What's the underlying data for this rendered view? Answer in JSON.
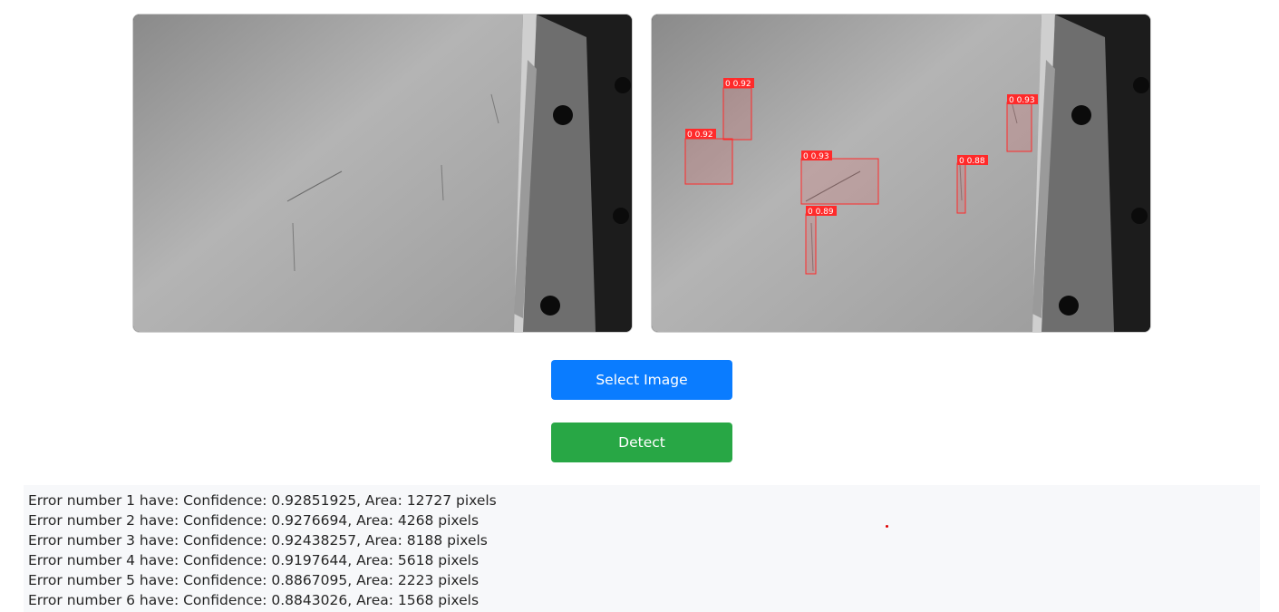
{
  "images": {
    "original": {
      "name": "input-image"
    },
    "result": {
      "name": "detection-result",
      "detections": [
        {
          "label": "0 0.92"
        },
        {
          "label": "0 0.92"
        },
        {
          "label": "0 0.93"
        },
        {
          "label": "0 0.89"
        },
        {
          "label": "0 0.88"
        },
        {
          "label": "0 0.93"
        }
      ]
    }
  },
  "buttons": {
    "select_label": "Select Image",
    "detect_label": "Detect"
  },
  "results": {
    "lines": [
      "Error number 1 have: Confidence: 0.92851925, Area: 12727 pixels",
      "Error number 2 have: Confidence: 0.9276694, Area: 4268 pixels",
      "Error number 3 have: Confidence: 0.92438257, Area: 8188 pixels",
      "Error number 4 have: Confidence: 0.9197644, Area: 5618 pixels",
      "Error number 5 have: Confidence: 0.8867095, Area: 2223 pixels",
      "Error number 6 have: Confidence: 0.8843026, Area: 1568 pixels"
    ]
  },
  "colors": {
    "select_button": "#0a7cff",
    "detect_button": "#28a745",
    "detection_box": "#ff2a2a"
  }
}
